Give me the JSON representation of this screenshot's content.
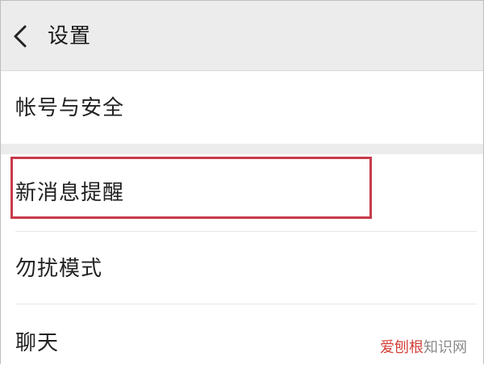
{
  "header": {
    "back_icon": "chevron-left-icon",
    "title": "设置"
  },
  "settings_items": [
    {
      "label": "帐号与安全"
    },
    {
      "label": "新消息提醒",
      "highlighted": true
    },
    {
      "label": "勿扰模式"
    },
    {
      "label": "聊天"
    }
  ],
  "watermark": {
    "accent": "爱刨根",
    "rest": "知识网"
  },
  "colors": {
    "header_bg": "#ececec",
    "highlight_border": "#c83a4a",
    "text": "#222222",
    "watermark_accent": "#d3413a",
    "watermark_text": "#8a8a8a"
  }
}
